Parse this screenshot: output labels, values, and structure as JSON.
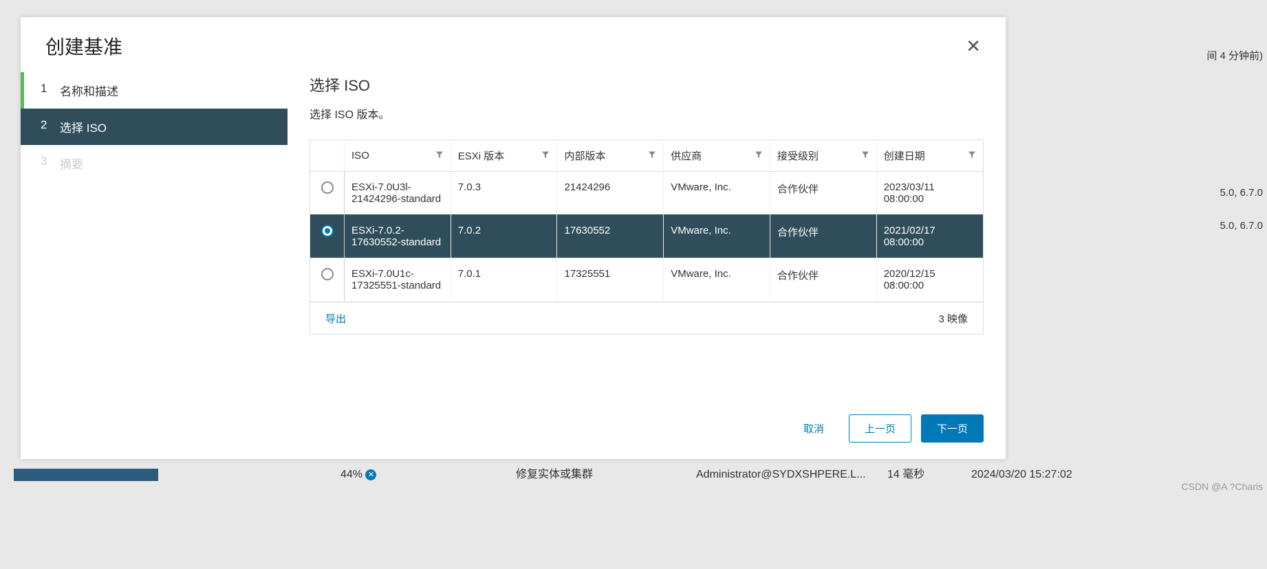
{
  "modal": {
    "title": "创建基准",
    "steps": [
      {
        "num": "1",
        "label": "名称和描述"
      },
      {
        "num": "2",
        "label": "选择 ISO"
      },
      {
        "num": "3",
        "label": "摘要"
      }
    ],
    "content": {
      "title": "选择 ISO",
      "subtitle": "选择 ISO 版本。"
    },
    "table": {
      "headers": {
        "iso": "ISO",
        "esxi_version": "ESXi 版本",
        "build": "内部版本",
        "vendor": "供应商",
        "accept_level": "接受级别",
        "created": "创建日期"
      },
      "rows": [
        {
          "iso": "ESXi-7.0U3l-21424296-standard",
          "esxi": "7.0.3",
          "build": "21424296",
          "vendor": "VMware, Inc.",
          "accept": "合作伙伴",
          "created": "2023/03/11 08:00:00",
          "selected": false
        },
        {
          "iso": "ESXi-7.0.2-17630552-standard",
          "esxi": "7.0.2",
          "build": "17630552",
          "vendor": "VMware, Inc.",
          "accept": "合作伙伴",
          "created": "2021/02/17 08:00:00",
          "selected": true
        },
        {
          "iso": "ESXi-7.0U1c-17325551-standard",
          "esxi": "7.0.1",
          "build": "17325551",
          "vendor": "VMware, Inc.",
          "accept": "合作伙伴",
          "created": "2020/12/15 08:00:00",
          "selected": false
        }
      ],
      "export_label": "导出",
      "count_label": "3 映像"
    },
    "buttons": {
      "cancel": "取消",
      "prev": "上一页",
      "next": "下一页"
    }
  },
  "backdrop": {
    "top_right": "间 4 分钟前)",
    "row1": "5.0, 6.7.0",
    "row2": "5.0, 6.7.0"
  },
  "status": {
    "progress_pct": "44%",
    "task": "修复实体或集群",
    "user": "Administrator@SYDXSHPERE.L...",
    "duration": "14 毫秒",
    "timestamp": "2024/03/20 15:27:02"
  },
  "watermark": "CSDN @A ?Charis"
}
